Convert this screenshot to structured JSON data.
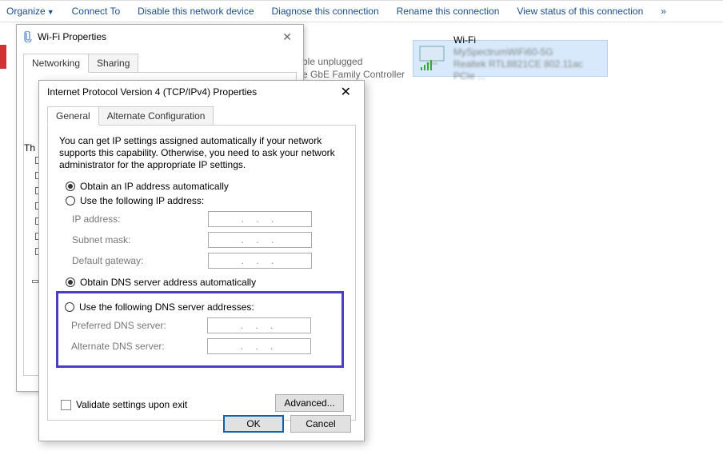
{
  "toolbar": {
    "organize": "Organize",
    "connect": "Connect To",
    "disable": "Disable this network device",
    "diagnose": "Diagnose this connection",
    "rename": "Rename this connection",
    "view_status": "View status of this connection",
    "more": "»"
  },
  "wifi_tile": {
    "title": "Wi-Fi",
    "line2": "MySpectrumWiFi60-5G",
    "line3": "Realtek RTL8821CE 802.11ac PCIe ..."
  },
  "bg": {
    "unplugged": "ble unplugged",
    "controller": "e GbE Family Controller"
  },
  "wifi_props": {
    "title": "Wi-Fi Properties",
    "tabs": {
      "networking": "Networking",
      "sharing": "Sharing"
    },
    "th_label": "Th"
  },
  "ipv4": {
    "title": "Internet Protocol Version 4 (TCP/IPv4) Properties",
    "tabs": {
      "general": "General",
      "alt": "Alternate Configuration"
    },
    "desc": "You can get IP settings assigned automatically if your network supports this capability. Otherwise, you need to ask your network administrator for the appropriate IP settings.",
    "ip": {
      "auto": "Obtain an IP address automatically",
      "manual": "Use the following IP address:",
      "addr_lbl": "IP address:",
      "mask_lbl": "Subnet mask:",
      "gw_lbl": "Default gateway:"
    },
    "dns": {
      "auto": "Obtain DNS server address automatically",
      "manual": "Use the following DNS server addresses:",
      "pref_lbl": "Preferred DNS server:",
      "alt_lbl": "Alternate DNS server:"
    },
    "validate": "Validate settings upon exit",
    "advanced": "Advanced...",
    "ok": "OK",
    "cancel": "Cancel",
    "ip_placeholder": ".   .   ."
  }
}
